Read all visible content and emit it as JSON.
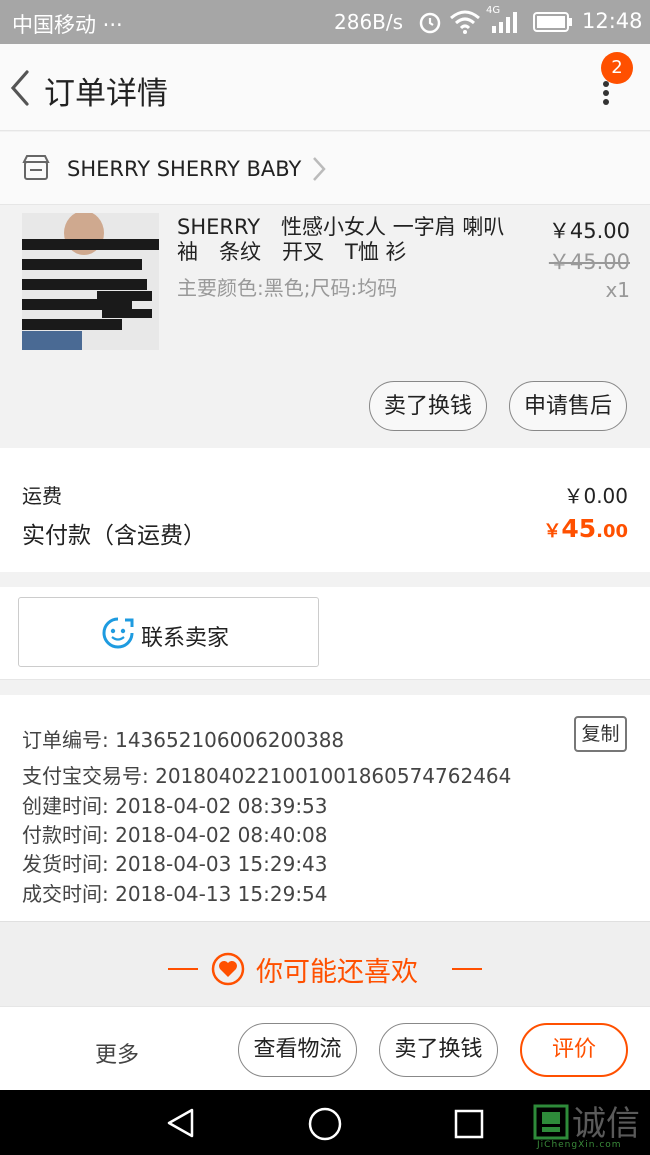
{
  "status_bar": {
    "carrier": "中国移动 ···",
    "speed": "286B/s",
    "network": "4G",
    "time": "12:48"
  },
  "header": {
    "title": "订单详情",
    "badge_count": "2"
  },
  "shop": {
    "name": "SHERRY SHERRY BABY"
  },
  "product": {
    "title": "SHERRY　性感小女人 一字肩 喇叭袖　条纹　开叉　T恤 衫",
    "sku": "主要颜色:黑色;尺码:均码",
    "price": "￥45.00",
    "original_price": "￥45.00",
    "quantity": "x1",
    "actions": [
      "卖了换钱",
      "申请售后"
    ]
  },
  "fees": {
    "shipping_label": "运费",
    "shipping_value": "￥0.00",
    "paid_label": "实付款（含运费）",
    "paid_currency": "￥",
    "paid_integer": "45",
    "paid_decimal": ".00"
  },
  "contact": {
    "label": "联系卖家"
  },
  "order_info": {
    "copy_label": "复制",
    "rows": [
      "订单编号: 143652106006200388",
      "支付宝交易号: 2018040221001001860574762464",
      "创建时间: 2018-04-02 08:39:53",
      "付款时间: 2018-04-02 08:40:08",
      "发货时间: 2018-04-03 15:29:43",
      "成交时间: 2018-04-13 15:29:54"
    ]
  },
  "recommend": {
    "label": "你可能还喜欢"
  },
  "bottom_bar": {
    "more": "更多",
    "buttons": [
      "查看物流",
      "卖了换钱",
      "评价"
    ]
  },
  "watermark": {
    "text": "诚信",
    "sub": "JiChengXin.com"
  },
  "colors": {
    "accent": "#ff5000",
    "status_bar": "#a6a6a6",
    "background": "#f2f2f2"
  }
}
